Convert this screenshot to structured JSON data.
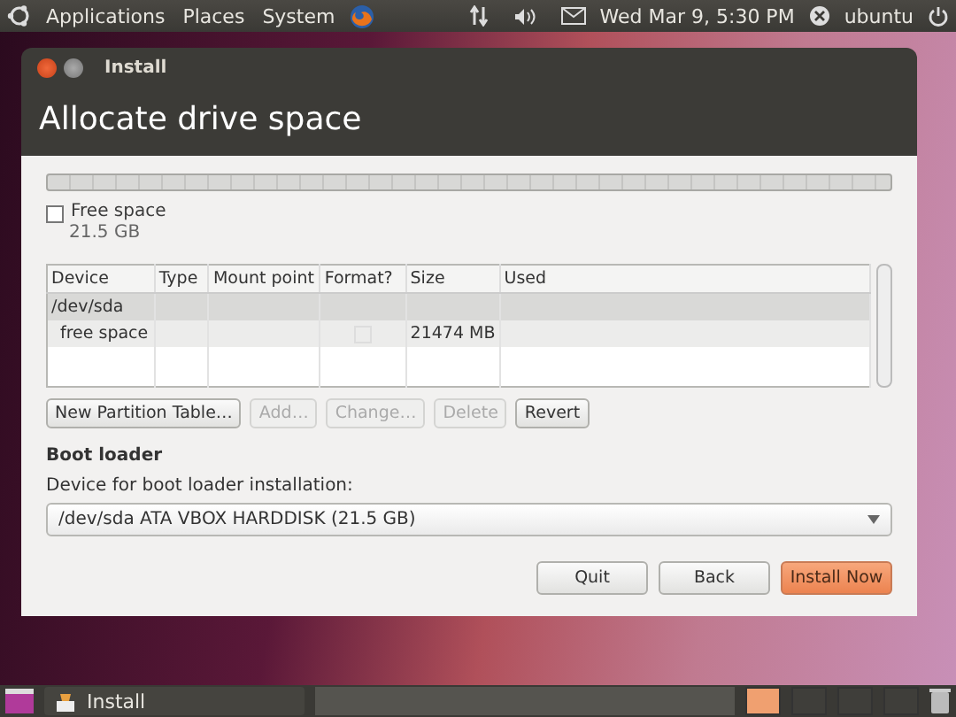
{
  "top_panel": {
    "menus": [
      "Applications",
      "Places",
      "System"
    ],
    "clock": "Wed Mar 9, 5:30 PM",
    "user": "ubuntu"
  },
  "window": {
    "title": "Install",
    "heading": "Allocate drive space"
  },
  "partition_legend": {
    "label": "Free space",
    "checked": false,
    "size": "21.5 GB"
  },
  "table": {
    "columns": [
      "Device",
      "Type",
      "Mount point",
      "Format?",
      "Size",
      "Used"
    ],
    "rows": [
      {
        "device": "/dev/sda",
        "selected": true,
        "children": [
          {
            "device": "free space",
            "format": false,
            "size": "21474 MB",
            "selected": false
          }
        ]
      }
    ]
  },
  "partition_buttons": [
    {
      "label": "New Partition Table…",
      "disabled": false
    },
    {
      "label": "Add…",
      "disabled": true
    },
    {
      "label": "Change…",
      "disabled": true
    },
    {
      "label": "Delete",
      "disabled": true
    },
    {
      "label": "Revert",
      "disabled": false
    }
  ],
  "boot_loader": {
    "heading": "Boot loader",
    "label": "Device for boot loader installation:",
    "value": "/dev/sda ATA VBOX HARDDISK (21.5 GB)"
  },
  "footer_buttons": [
    {
      "label": "Quit",
      "primary": false
    },
    {
      "label": "Back",
      "primary": false
    },
    {
      "label": "Install Now",
      "primary": true
    }
  ],
  "taskbar": {
    "tasks": [
      "Install"
    ]
  }
}
